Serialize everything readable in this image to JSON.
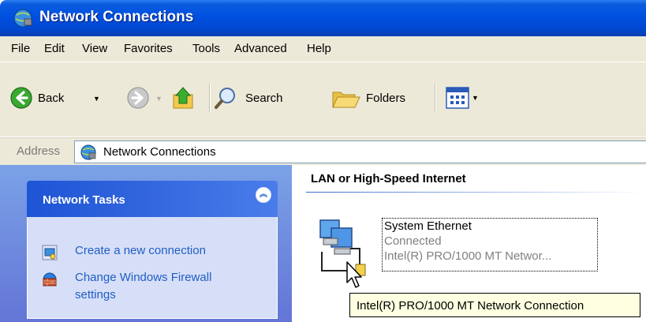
{
  "window": {
    "title": "Network Connections"
  },
  "menu": {
    "items": [
      "File",
      "Edit",
      "View",
      "Favorites",
      "Tools",
      "Advanced",
      "Help"
    ]
  },
  "toolbar": {
    "back_label": "Back",
    "search_label": "Search",
    "folders_label": "Folders"
  },
  "address": {
    "label": "Address",
    "value": "Network Connections"
  },
  "tasks": {
    "title": "Network Tasks",
    "items": [
      {
        "label_line1": "Create a new connection"
      },
      {
        "label_line1": "Change Windows Firewall",
        "label_line2": "settings"
      }
    ]
  },
  "group": {
    "title": "LAN or High-Speed Internet",
    "connection": {
      "name": "System Ethernet",
      "status": "Connected",
      "device": "Intel(R) PRO/1000 MT Networ..."
    }
  },
  "tooltip": {
    "text": "Intel(R) PRO/1000 MT Network Connection"
  },
  "colors": {
    "titlebar": "#0050e0",
    "chrome": "#ece9d8",
    "task_link": "#215dc6",
    "taskpane": "#7ba2e7",
    "tooltip_bg": "#ffffe1"
  },
  "icons": {
    "title": "network-connections-icon",
    "back": "back-arrow-icon",
    "forward": "forward-arrow-icon",
    "up": "folder-up-icon",
    "search": "magnifier-icon",
    "folders": "folders-icon",
    "views": "views-icon",
    "collapse": "chevron-up-double-icon"
  }
}
